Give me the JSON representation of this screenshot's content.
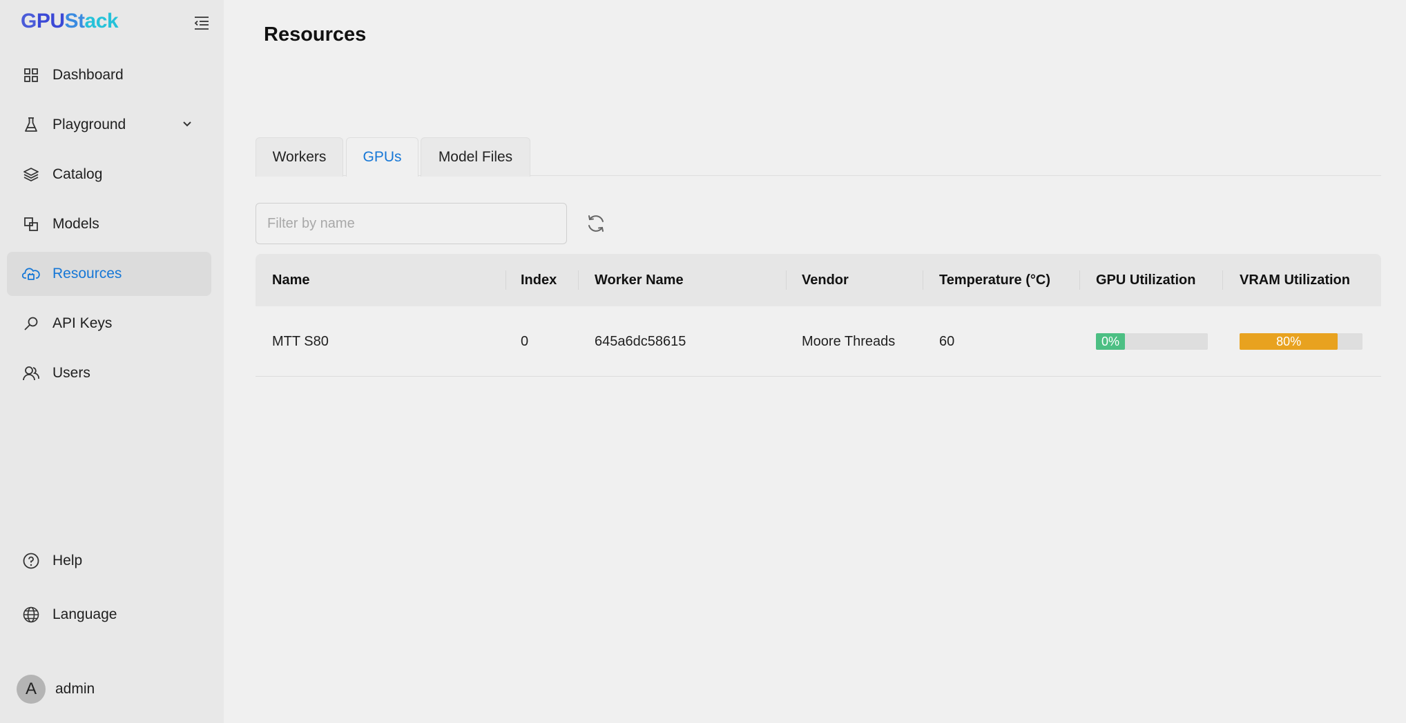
{
  "app": {
    "logo": {
      "g": "G",
      "pu": "PU",
      "st": "St",
      "ack": "ack"
    }
  },
  "sidebar": {
    "items": [
      {
        "label": "Dashboard",
        "icon": "dashboard-icon"
      },
      {
        "label": "Playground",
        "icon": "flask-icon"
      },
      {
        "label": "Catalog",
        "icon": "layers-icon"
      },
      {
        "label": "Models",
        "icon": "models-icon"
      },
      {
        "label": "Resources",
        "icon": "cloud-chip-icon"
      },
      {
        "label": "API Keys",
        "icon": "key-icon"
      },
      {
        "label": "Users",
        "icon": "users-icon"
      }
    ],
    "bottom": [
      {
        "label": "Help",
        "icon": "help-icon"
      },
      {
        "label": "Language",
        "icon": "globe-icon"
      }
    ],
    "user": {
      "initial": "A",
      "name": "admin"
    }
  },
  "page": {
    "title": "Resources"
  },
  "tabs": [
    "Workers",
    "GPUs",
    "Model Files"
  ],
  "search": {
    "placeholder": "Filter by name",
    "value": ""
  },
  "table": {
    "headers": [
      "Name",
      "Index",
      "Worker Name",
      "Vendor",
      "Temperature (°C)",
      "GPU Utilization",
      "VRAM Utilization"
    ],
    "rows": [
      {
        "name": "MTT S80",
        "index": "0",
        "worker_name": "645a6dc58615",
        "vendor": "Moore Threads",
        "temperature": "60",
        "gpu_utilization": {
          "label": "0%",
          "value": 0
        },
        "vram_utilization": {
          "label": "80%",
          "value": 80
        }
      }
    ]
  },
  "colors": {
    "accent": "#1677d6",
    "gpu_bar": "#4cbf83",
    "vram_bar": "#e8a21f"
  }
}
